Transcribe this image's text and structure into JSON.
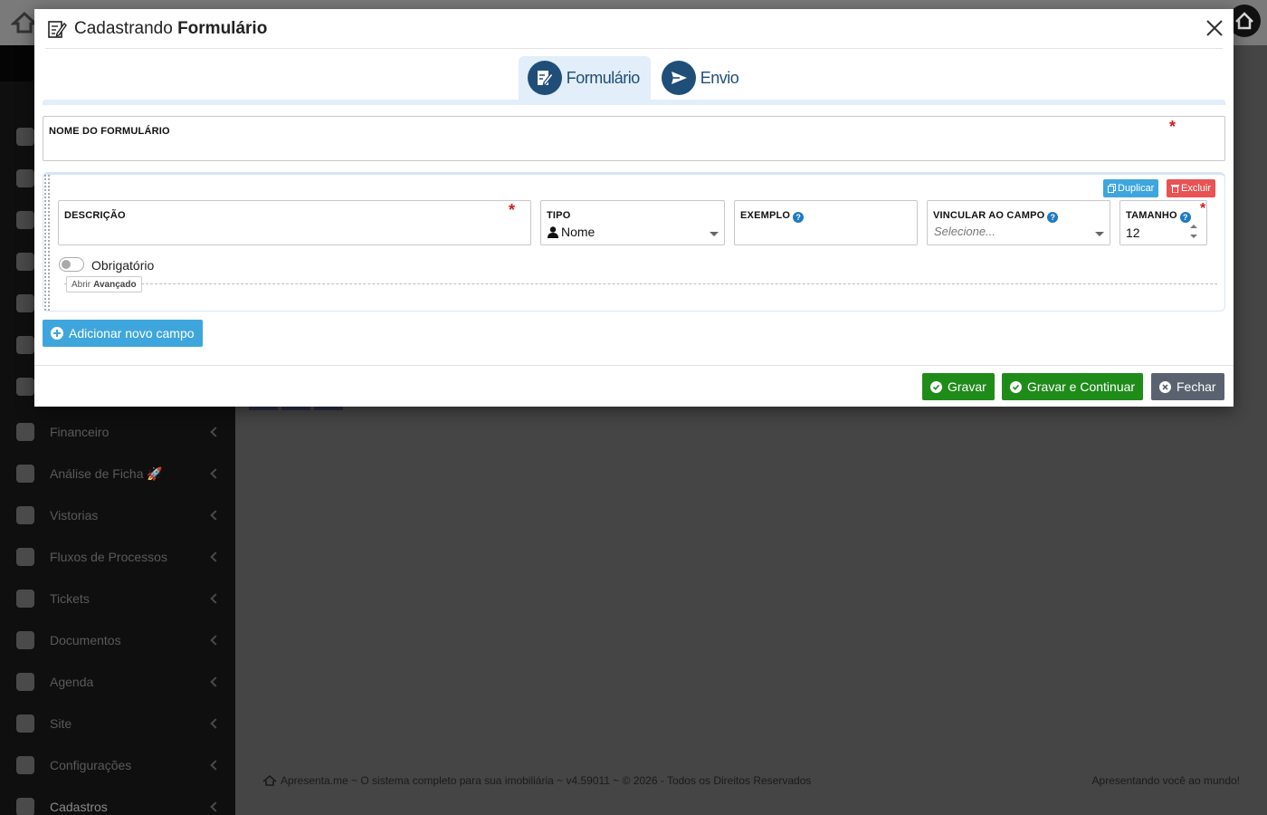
{
  "background": {
    "sidebar_items": [
      {
        "label": ""
      },
      {
        "label": ""
      },
      {
        "label": ""
      },
      {
        "label": ""
      },
      {
        "label": ""
      },
      {
        "label": ""
      },
      {
        "label": ""
      },
      {
        "label": "Financeiro"
      },
      {
        "label": "Análise de Ficha 🚀"
      },
      {
        "label": "Vistorias"
      },
      {
        "label": "Fluxos de Processos"
      },
      {
        "label": "Tickets"
      },
      {
        "label": "Documentos"
      },
      {
        "label": "Agenda"
      },
      {
        "label": "Site"
      },
      {
        "label": "Configurações"
      },
      {
        "label": "Cadastros"
      }
    ],
    "footer_left": "Apresenta.me ~ O sistema completo para sua imobiliária ~ v4.59011 ~ © 2026 - Todos os Direitos Reservados",
    "footer_right": "Apresentando você ao mundo!"
  },
  "modal": {
    "title_prefix": "Cadastrando",
    "title_bold": "Formulário",
    "tabs": [
      {
        "label": "Formulário",
        "icon": "form-edit-icon",
        "active": true
      },
      {
        "label": "Envio",
        "icon": "send-icon",
        "active": false
      }
    ],
    "form_name": {
      "label": "NOME DO FORMULÁRIO",
      "value": "",
      "required_mark": "*"
    },
    "field_block": {
      "duplicate_label": "Duplicar",
      "delete_label": "Excluir",
      "descricao": {
        "label": "DESCRIÇÃO",
        "value": "",
        "required_mark": "*"
      },
      "tipo": {
        "label": "TIPO",
        "value": "Nome",
        "icon": "user-icon"
      },
      "exemplo": {
        "label": "EXEMPLO",
        "value": "",
        "help": "?"
      },
      "vincular": {
        "label": "VINCULAR AO CAMPO",
        "placeholder": "Selecione...",
        "help": "?"
      },
      "tamanho": {
        "label": "TAMANHO",
        "value": "12",
        "help": "?",
        "required_mark": "*"
      },
      "obrigatorio_label": "Obrigatório",
      "obrigatorio_on": false,
      "advanced_prefix": "Abrir",
      "advanced_bold": "Avançado"
    },
    "add_field_label": "Adicionar novo campo",
    "footer": {
      "save_label": "Gravar",
      "save_continue_label": "Gravar e Continuar",
      "close_label": "Fechar"
    }
  },
  "colors": {
    "primary": "#1f4e79",
    "info": "#3ea6dd",
    "danger": "#e85353",
    "success": "#1f8c1a",
    "secondary": "#5a6270"
  }
}
